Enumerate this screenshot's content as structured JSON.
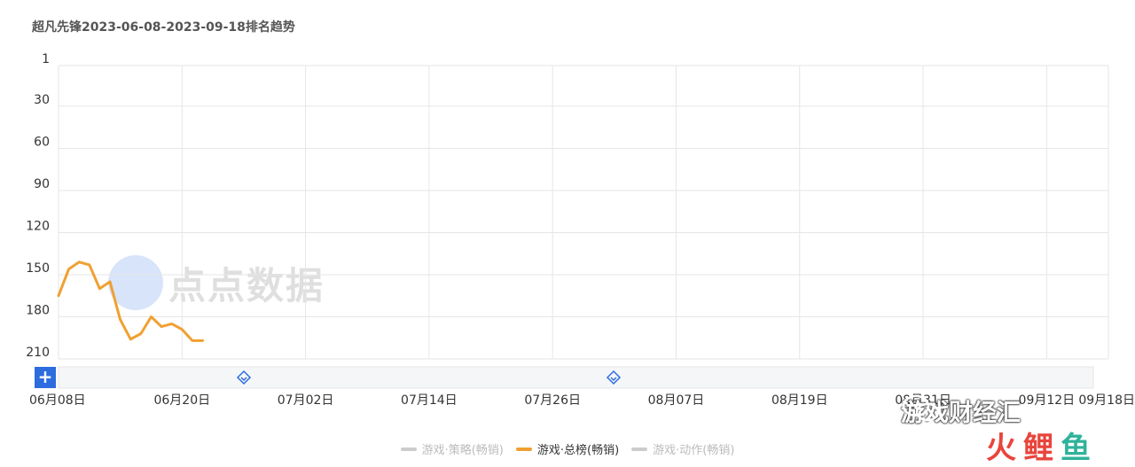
{
  "title": "超凡先锋2023-06-08-2023-09-18排名趋势",
  "watermark": "点点数据",
  "overlay_text": "游戏财经汇",
  "brand_chars": [
    "火",
    "鲤",
    "鱼"
  ],
  "slider": {
    "plus": "+"
  },
  "colors": {
    "accent": "#f0a032",
    "inactive": "#cccccc",
    "grid": "#e6e6e6",
    "slider_button": "#2d6cdf"
  },
  "chart_data": {
    "type": "line",
    "title": "超凡先锋2023-06-08-2023-09-18排名趋势",
    "xlabel": "",
    "ylabel": "",
    "y_inverted": true,
    "ylim": [
      1,
      210
    ],
    "y_ticks": [
      "1",
      "30",
      "60",
      "90",
      "120",
      "150",
      "180",
      "210"
    ],
    "x_ticks": [
      "06月08日",
      "06月20日",
      "07月02日",
      "07月14日",
      "07月26日",
      "08月07日",
      "08月19日",
      "08月31日",
      "09月12日",
      "09月18日"
    ],
    "x_tick_dates": [
      "2023-06-08",
      "2023-06-20",
      "2023-07-02",
      "2023-07-14",
      "2023-07-26",
      "2023-08-07",
      "2023-08-19",
      "2023-08-31",
      "2023-09-12",
      "2023-09-18"
    ],
    "xlim": [
      "2023-06-08",
      "2023-09-18"
    ],
    "grid": true,
    "legend_position": "bottom",
    "series": [
      {
        "name": "游戏·策略(畅销)",
        "color": "#cccccc",
        "active": false,
        "x": [],
        "values": []
      },
      {
        "name": "游戏·总榜(畅销)",
        "color": "#f0a032",
        "active": true,
        "x": [
          "2023-06-08",
          "2023-06-09",
          "2023-06-10",
          "2023-06-11",
          "2023-06-12",
          "2023-06-13",
          "2023-06-14",
          "2023-06-15",
          "2023-06-16",
          "2023-06-17",
          "2023-06-18",
          "2023-06-19",
          "2023-06-20",
          "2023-06-21",
          "2023-06-22"
        ],
        "values": [
          165,
          146,
          141,
          143,
          160,
          155,
          182,
          196,
          192,
          180,
          187,
          185,
          189,
          197,
          197
        ]
      },
      {
        "name": "游戏·动作(畅销)",
        "color": "#cccccc",
        "active": false,
        "x": [],
        "values": []
      }
    ]
  }
}
